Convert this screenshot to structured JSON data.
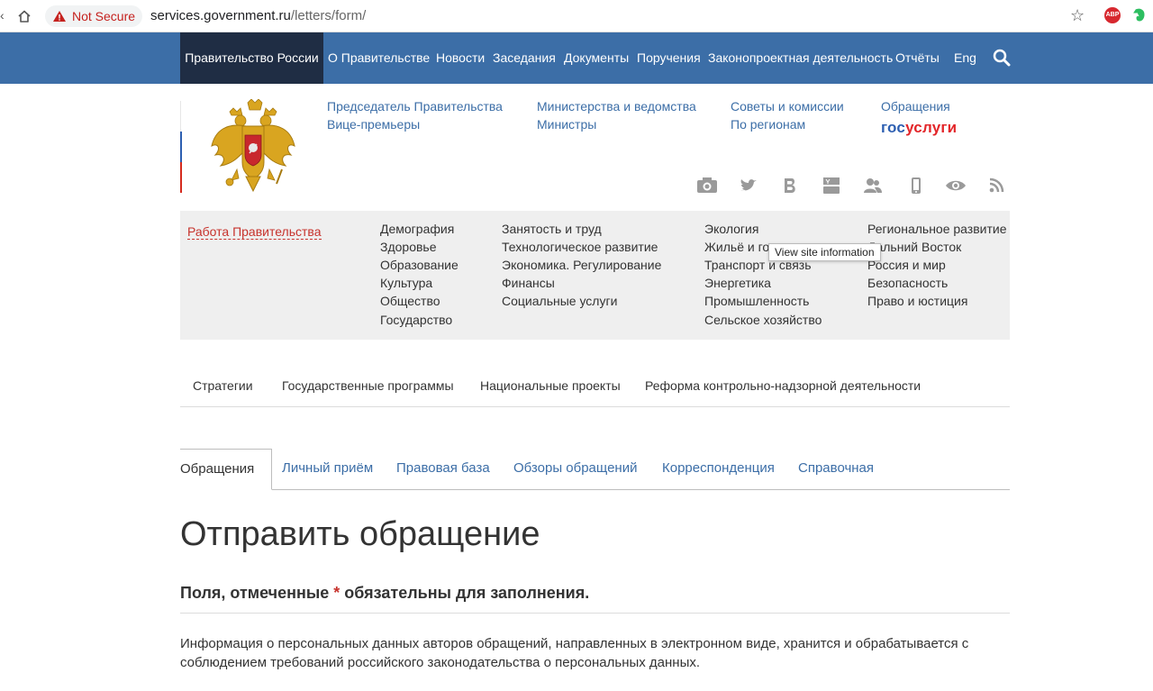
{
  "browser": {
    "security_label": "Not Secure",
    "url_host": "services.government.ru",
    "url_path": "/letters/form/",
    "extension_abp": "ABP"
  },
  "topnav": {
    "home": "Правительство России",
    "items": [
      "О Правительстве",
      "Новости",
      "Заседания",
      "Документы",
      "Поручения",
      "Законопроектная деятельность",
      "Отчёты",
      "Eng"
    ]
  },
  "header_links": {
    "col1": [
      "Председатель Правительства",
      "Вице-премьеры"
    ],
    "col2": [
      "Министерства и ведомства",
      "Министры"
    ],
    "col3": [
      "Советы и комиссии",
      "По регионам"
    ],
    "col4": [
      "Обращения"
    ],
    "gosuslugi_a": "гос",
    "gosuslugi_b": "услуги"
  },
  "social_icons": [
    "camera-icon",
    "twitter-icon",
    "vk-icon",
    "youtube-icon",
    "users-icon",
    "mobile-icon",
    "eye-icon",
    "rss-icon"
  ],
  "topics": {
    "work_label": "Работа Правительства",
    "col1": [
      "Демография",
      "Здоровье",
      "Образование",
      "Культура",
      "Общество",
      "Государство"
    ],
    "col2": [
      "Занятость и труд",
      "Технологическое развитие",
      "Экономика. Регулирование",
      "Финансы",
      "Социальные услуги"
    ],
    "col3": [
      "Экология",
      "Жильё и го",
      "Транспорт и связь",
      "Энергетика",
      "Промышленность",
      "Сельское хозяйство"
    ],
    "col4": [
      "Региональное развитие",
      "Дальний Восток",
      "Россия и мир",
      "Безопасность",
      "Право и юстиция"
    ]
  },
  "tooltip": "View site information",
  "subnav": [
    "Стратегии",
    "Государственные программы",
    "Национальные проекты",
    "Реформа контрольно-надзорной деятельности"
  ],
  "tabs": {
    "active": "Обращения",
    "items": [
      "Личный приём",
      "Правовая база",
      "Обзоры обращений",
      "Корреспонденция",
      "Справочная"
    ]
  },
  "content": {
    "title": "Отправить обращение",
    "required_before": "Поля, отмеченные ",
    "required_star": "*",
    "required_after": " обязательны для заполнения.",
    "info": "Информация о персональных данных авторов обращений, направленных в электронном виде, хранится и обрабатывается с соблюдением требований российского законодательства о персональных данных."
  },
  "colors": {
    "nav_blue": "#3c6ea7",
    "nav_dark": "#1f2d44",
    "accent_red": "#c7332d",
    "topics_bg": "#efefef"
  }
}
